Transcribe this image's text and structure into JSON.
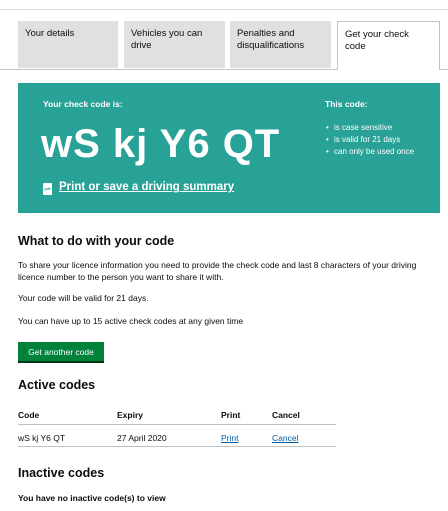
{
  "tabs": [
    {
      "label": "Your details"
    },
    {
      "label": "Vehicles you can drive"
    },
    {
      "label": "Penalties and disqualifications"
    },
    {
      "label": "Get your check code",
      "active": true
    }
  ],
  "banner": {
    "code_label": "Your check code is:",
    "code": "wS kj Y6 QT",
    "print_icon": "pdf-icon",
    "print_icon_text": "pdf",
    "print_link": "Print or save a driving summary",
    "this_code_label": "This code:",
    "properties": [
      "is case sensitive",
      "is valid for 21 days",
      "can only be used once"
    ],
    "color": "#28a197"
  },
  "what_to_do": {
    "heading": "What to do with your code",
    "para1": "To share your licence information you need to provide the check code and last 8 characters of your driving licence number to the person you want to share it with.",
    "para2": "Your code will be valid for 21 days.",
    "para3": "You can have up to 15 active check codes at any given time",
    "button": "Get another code",
    "button_color": "#00823b"
  },
  "active_codes": {
    "heading": "Active codes",
    "columns": [
      "Code",
      "Expiry",
      "Print",
      "Cancel"
    ],
    "rows": [
      {
        "code": "wS kj Y6 QT",
        "expiry": "27 April 2020",
        "print": "Print",
        "cancel": "Cancel"
      }
    ]
  },
  "inactive_codes": {
    "heading": "Inactive codes",
    "message": "You have no inactive code(s) to view"
  }
}
